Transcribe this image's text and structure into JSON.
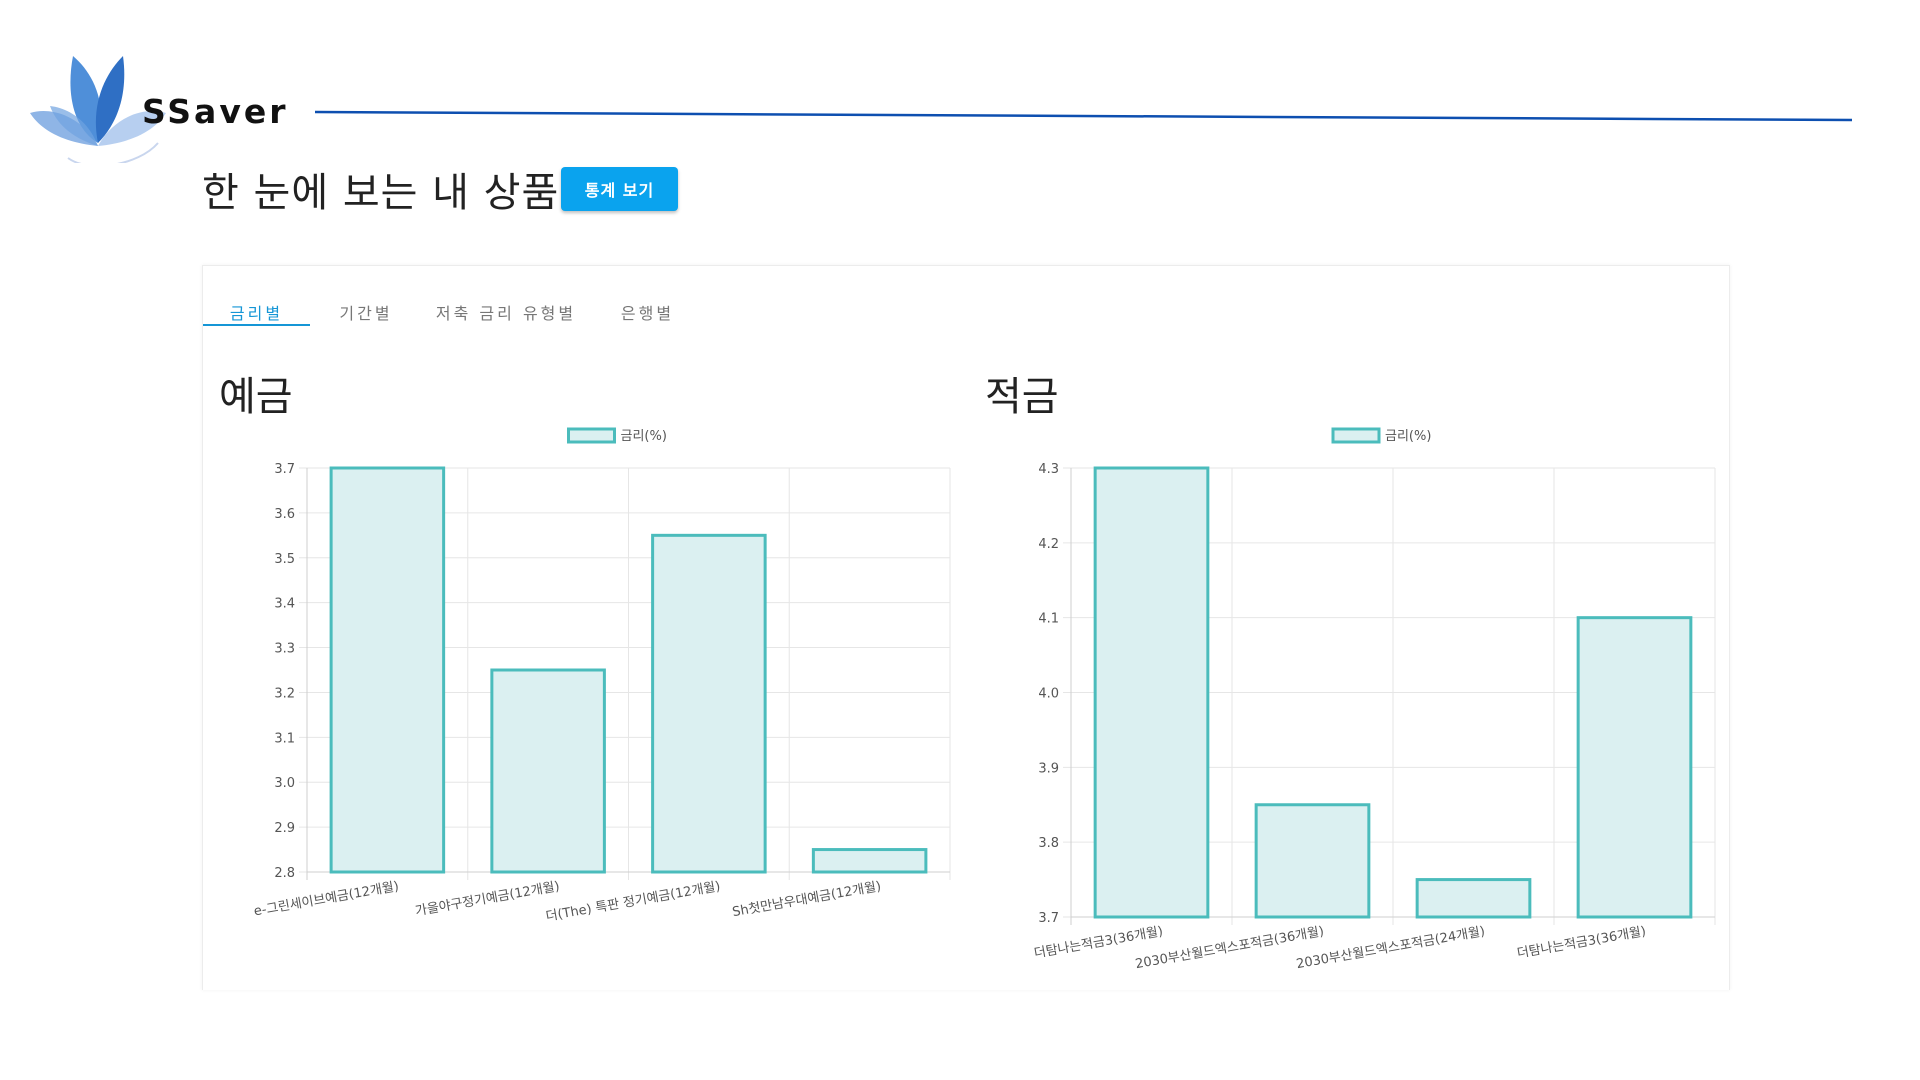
{
  "brand": {
    "name": "SSaver"
  },
  "colors": {
    "accent": "#0aa3ee",
    "tab_active": "#1596d6",
    "bar_fill": "#dbf0f1",
    "bar_border": "#4bbcbc",
    "rule": "#0d4fb0"
  },
  "header": {
    "title": "한 눈에 보는 내 상품",
    "stats_button": "통계 보기"
  },
  "tabs": [
    {
      "label": "금리별",
      "active": true
    },
    {
      "label": "기간별",
      "active": false
    },
    {
      "label": "저축 금리 유형별",
      "active": false
    },
    {
      "label": "은행별",
      "active": false
    }
  ],
  "sections": {
    "deposit_title": "예금",
    "savings_title": "적금"
  },
  "chart_data": [
    {
      "type": "bar",
      "legend": "금리(%)",
      "legend_position": "top",
      "grid": true,
      "categories": [
        "e-그린세이브예금(12개월)",
        "가을야구정기예금(12개월)",
        "더(The) 특판 정기예금(12개월)",
        "Sh첫만남우대예금(12개월)"
      ],
      "series": [
        {
          "name": "금리(%)",
          "values": [
            3.7,
            3.25,
            3.55,
            2.85
          ]
        }
      ],
      "ylim": [
        2.8,
        3.7
      ],
      "yticks": [
        "3.7",
        "3.6",
        "3.5",
        "3.4",
        "3.3",
        "3.2",
        "3.1",
        "3.0",
        "2.9",
        "2.8"
      ]
    },
    {
      "type": "bar",
      "legend": "금리(%)",
      "legend_position": "top",
      "grid": true,
      "categories": [
        "더탐나는적금3(36개월)",
        "2030부산월드엑스포적금(36개월)",
        "2030부산월드엑스포적금(24개월)",
        "더탐나는적금3(36개월)"
      ],
      "series": [
        {
          "name": "금리(%)",
          "values": [
            4.3,
            3.85,
            3.75,
            4.1
          ]
        }
      ],
      "ylim": [
        3.7,
        4.3
      ],
      "yticks": [
        "4.3",
        "4.2",
        "4.1",
        "4.0",
        "3.9",
        "3.8",
        "3.7"
      ]
    }
  ]
}
